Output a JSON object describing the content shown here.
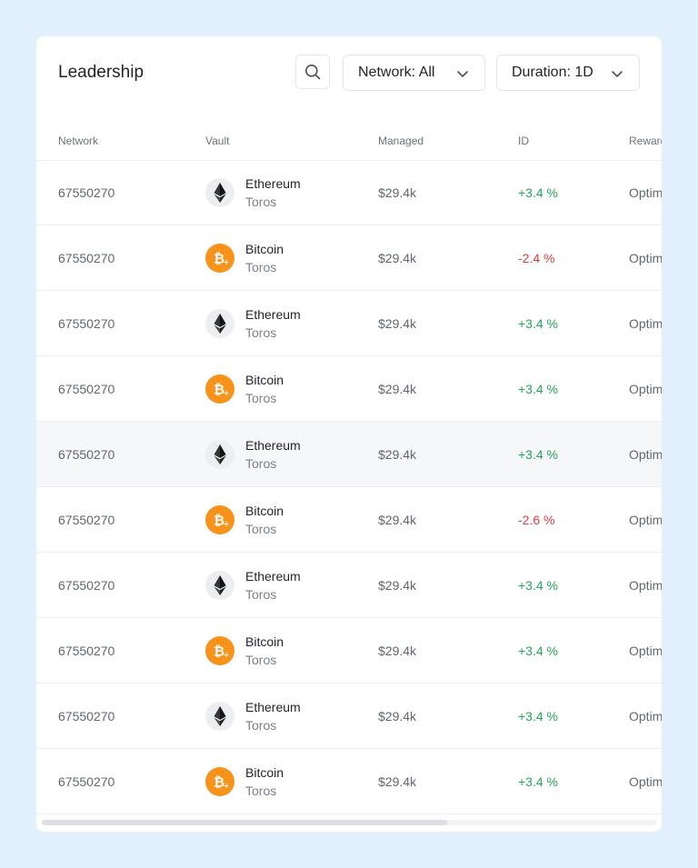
{
  "header": {
    "title": "Leadership",
    "network_filter": "Network: All",
    "duration_filter": "Duration: 1D"
  },
  "columns": [
    "Network",
    "Vault",
    "Managed",
    "ID",
    "Reward"
  ],
  "rows": [
    {
      "network": "67550270",
      "vault": "Ethereum",
      "vault_sub": "Toros",
      "coin": "eth",
      "managed": "$29.4k",
      "change": "+3.4 %",
      "trend": "pos",
      "reward": "Optimism"
    },
    {
      "network": "67550270",
      "vault": "Bitcoin",
      "vault_sub": "Toros",
      "coin": "btc",
      "managed": "$29.4k",
      "change": "-2.4 %",
      "trend": "neg",
      "reward": "Optimism"
    },
    {
      "network": "67550270",
      "vault": "Ethereum",
      "vault_sub": "Toros",
      "coin": "eth",
      "managed": "$29.4k",
      "change": "+3.4 %",
      "trend": "pos",
      "reward": "Optimism"
    },
    {
      "network": "67550270",
      "vault": "Bitcoin",
      "vault_sub": "Toros",
      "coin": "btc",
      "managed": "$29.4k",
      "change": "+3.4 %",
      "trend": "pos",
      "reward": "Optimism"
    },
    {
      "network": "67550270",
      "vault": "Ethereum",
      "vault_sub": "Toros",
      "coin": "eth",
      "managed": "$29.4k",
      "change": "+3.4 %",
      "trend": "pos",
      "reward": "Optimism",
      "highlight": true
    },
    {
      "network": "67550270",
      "vault": "Bitcoin",
      "vault_sub": "Toros",
      "coin": "btc",
      "managed": "$29.4k",
      "change": "-2.6 %",
      "trend": "neg",
      "reward": "Optimism"
    },
    {
      "network": "67550270",
      "vault": "Ethereum",
      "vault_sub": "Toros",
      "coin": "eth",
      "managed": "$29.4k",
      "change": "+3.4 %",
      "trend": "pos",
      "reward": "Optimism"
    },
    {
      "network": "67550270",
      "vault": "Bitcoin",
      "vault_sub": "Toros",
      "coin": "btc",
      "managed": "$29.4k",
      "change": "+3.4 %",
      "trend": "pos",
      "reward": "Optimism"
    },
    {
      "network": "67550270",
      "vault": "Ethereum",
      "vault_sub": "Toros",
      "coin": "eth",
      "managed": "$29.4k",
      "change": "+3.4 %",
      "trend": "pos",
      "reward": "Optimism"
    },
    {
      "network": "67550270",
      "vault": "Bitcoin",
      "vault_sub": "Toros",
      "coin": "btc",
      "managed": "$29.4k",
      "change": "+3.4 %",
      "trend": "pos",
      "reward": "Optimism"
    }
  ],
  "icons": {
    "search": "search-icon",
    "chevron": "chevron-down-icon",
    "eth": "ethereum-icon",
    "btc": "bitcoin-icon"
  },
  "colors": {
    "background": "#e2f0fd",
    "positive": "#22a85a",
    "negative": "#e23b3b",
    "bitcoin": "#f7931a"
  },
  "horizontal_scroll_fraction": 0.66
}
